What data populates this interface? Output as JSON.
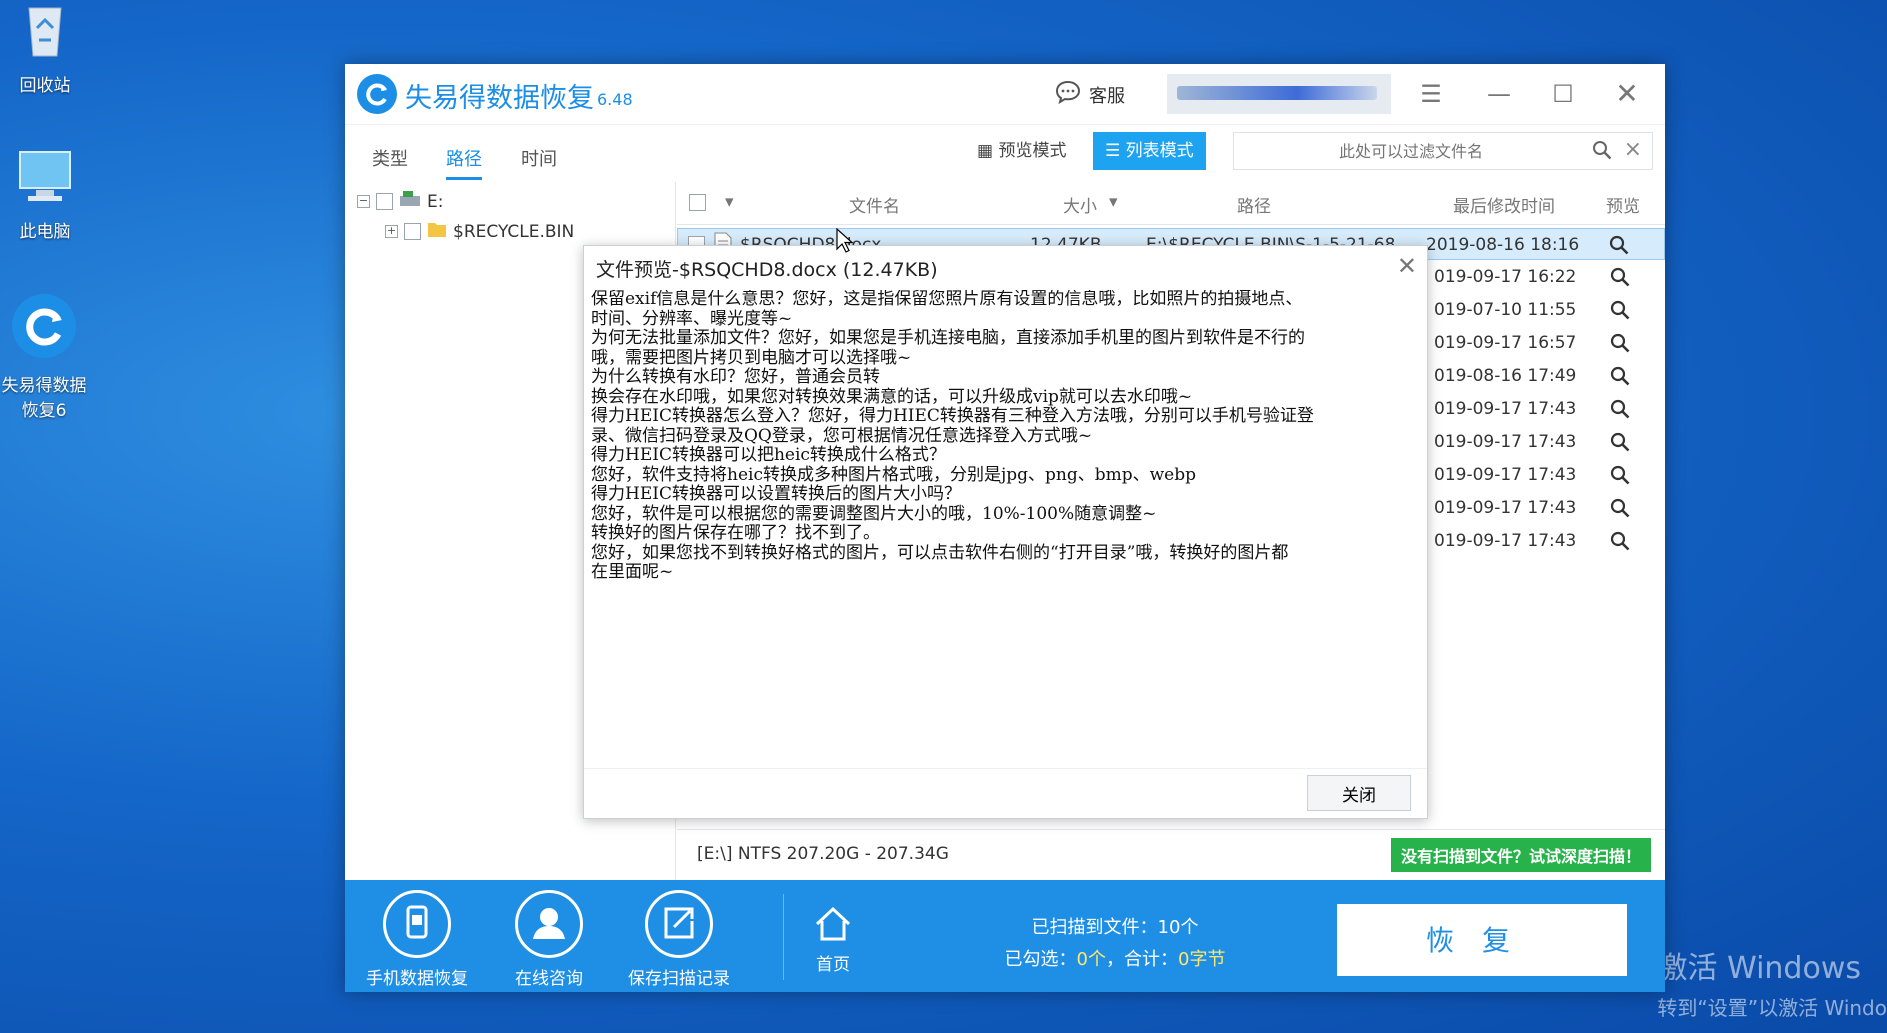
{
  "desktop": {
    "icons": [
      {
        "label": "回收站",
        "icon": "recycle-bin-icon"
      },
      {
        "label": "此电脑",
        "icon": "computer-icon"
      },
      {
        "label": "失易得数据恢复6",
        "icon": "app-icon"
      }
    ],
    "watermark": {
      "line1": "激活 Windows",
      "line2": "转到“设置”以激活 Windo"
    }
  },
  "app": {
    "title": "失易得数据恢复",
    "version": "6.48",
    "service_label": "客服",
    "tabs": [
      {
        "label": "类型"
      },
      {
        "label": "路径",
        "active": true
      },
      {
        "label": "时间"
      }
    ],
    "modes": {
      "preview": "预览模式",
      "list": "列表模式"
    },
    "filter_placeholder": "此处可以过滤文件名",
    "tree": {
      "drive": "E:",
      "folder": "$RECYCLE.BIN"
    },
    "columns": {
      "name": "文件名",
      "size": "大小",
      "path": "路径",
      "modified": "最后修改时间",
      "preview": "预览"
    },
    "files": [
      {
        "name": "$RSQCHD8.docx",
        "size": "12.47KB",
        "path": "E:\\$RECYCLE.BIN\\S-1-5-21-68...",
        "modified": "2019-08-16  18:16"
      },
      {
        "modified": "019-09-17  16:22"
      },
      {
        "modified": "019-07-10  11:55"
      },
      {
        "modified": "019-09-17  16:57"
      },
      {
        "modified": "019-08-16  17:49"
      },
      {
        "modified": "019-09-17  17:43"
      },
      {
        "modified": "019-09-17  17:43"
      },
      {
        "modified": "019-09-17  17:43"
      },
      {
        "modified": "019-09-17  17:43"
      },
      {
        "modified": "019-09-17  17:43"
      }
    ],
    "status": "[E:\\] NTFS 207.20G - 207.34G",
    "deep_scan": "没有扫描到文件？试试深度扫描！",
    "bottom": {
      "items": [
        {
          "label": "手机数据恢复",
          "icon": "phone-icon"
        },
        {
          "label": "在线咨询",
          "icon": "user-icon"
        },
        {
          "label": "保存扫描记录",
          "icon": "export-icon"
        },
        {
          "label": "首页",
          "icon": "home-icon"
        }
      ],
      "scanned_prefix": "已扫描到文件：",
      "scanned_count": "10个",
      "selected_prefix": "已勾选：",
      "selected_count": "0个",
      "total_prefix": "，合计：",
      "total_size": "0字节",
      "recover": "恢复"
    }
  },
  "dialog": {
    "title": "文件预览-$RSQCHD8.docx  (12.47KB)",
    "lines": [
      "保留exif信息是什么意思？您好，这是指保留您照片原有设置的信息哦，比如照片的拍摄地点、",
      "时间、分辨率、曝光度等~",
      "为何无法批量添加文件？您好，如果您是手机连接电脑，直接添加手机里的图片到软件是不行的",
      "哦，需要把图片拷贝到电脑才可以选择哦~",
      "为什么转换有水印？您好，普通会员转",
      "换会存在水印哦，如果您对转换效果满意的话，可以升级成vip就可以去水印哦~",
      "得力HEIC转换器怎么登入？您好，得力HIEC转换器有三种登入方法哦，分别可以手机号验证登",
      "录、微信扫码登录及QQ登录，您可根据情况任意选择登入方式哦~",
      "得力HEIC转换器可以把heic转换成什么格式？",
      "您好，软件支持将heic转换成多种图片格式哦，分别是jpg、png、bmp、webp",
      "得力HEIC转换器可以设置转换后的图片大小吗？",
      "您好，软件是可以根据您的需要调整图片大小的哦，10%-100%随意调整~",
      "转换好的图片保存在哪了？找不到了。",
      "您好，如果您找不到转换好格式的图片，可以点击软件右侧的“打开目录”哦，转换好的图片都",
      "在里面呢~"
    ],
    "close_label": "关闭"
  }
}
